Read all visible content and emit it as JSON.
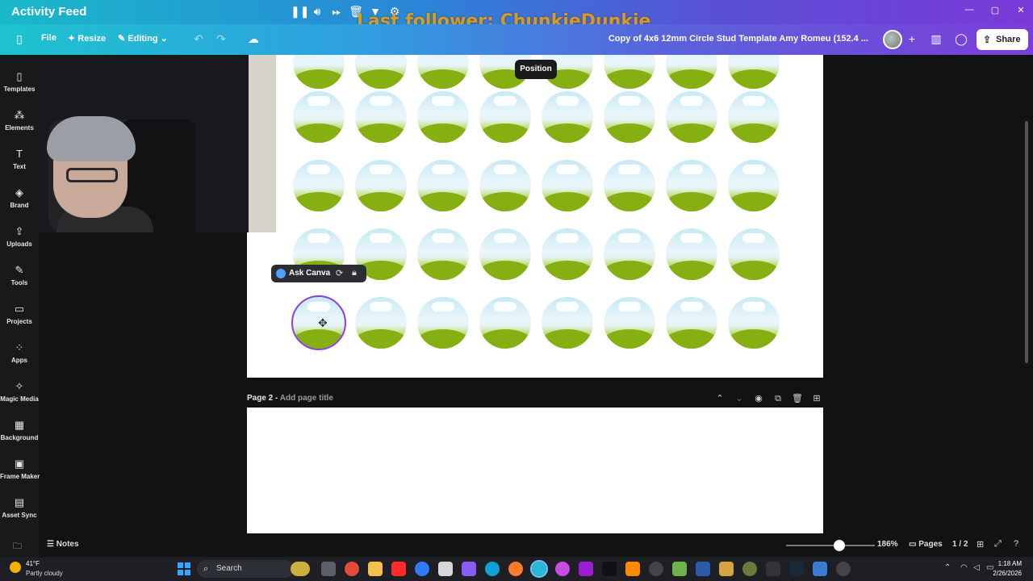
{
  "window": {
    "title": "Activity Feed",
    "follower_overlay": "Last follower: ChunkieDunkie"
  },
  "toolbar": {
    "file": "File",
    "resize": "Resize",
    "editing": "Editing",
    "doc_title": "Copy of 4x6 12mm Circle Stud Template Amy Romeu (152.4 ...",
    "share": "Share"
  },
  "sidebar": {
    "items": [
      {
        "label": "Templates",
        "icon": "templates-icon"
      },
      {
        "label": "Elements",
        "icon": "elements-icon"
      },
      {
        "label": "Text",
        "icon": "text-icon"
      },
      {
        "label": "Brand",
        "icon": "brand-icon"
      },
      {
        "label": "Uploads",
        "icon": "uploads-icon"
      },
      {
        "label": "Tools",
        "icon": "tools-icon"
      },
      {
        "label": "Projects",
        "icon": "projects-icon"
      },
      {
        "label": "Apps",
        "icon": "apps-icon"
      },
      {
        "label": "Magic Media",
        "icon": "magic-media-icon"
      },
      {
        "label": "Background",
        "icon": "background-icon"
      },
      {
        "label": "Frame Maker",
        "icon": "frame-maker-icon"
      },
      {
        "label": "Asset Sync",
        "icon": "asset-sync-icon"
      }
    ]
  },
  "canvas": {
    "position_tooltip": "Position",
    "ask_canva": "Ask Canva",
    "page2_label": "Page 2 -",
    "page2_placeholder": "Add page title"
  },
  "bottombar": {
    "notes": "Notes",
    "zoom": "186%",
    "zoom_fraction": 0.6,
    "pages": "Pages",
    "page_count": "1 / 2"
  },
  "taskbar": {
    "temperature": "41°F",
    "weather": "Partly cloudy",
    "search": "Search",
    "time": "1:18 AM",
    "date": "2/26/2026"
  },
  "colors": {
    "accent": "#8b3ddf",
    "toolbar_start": "#1dc3cf",
    "toolbar_end": "#7b3dd9",
    "grass": "#86b012",
    "sky": "#c7e9f4"
  }
}
